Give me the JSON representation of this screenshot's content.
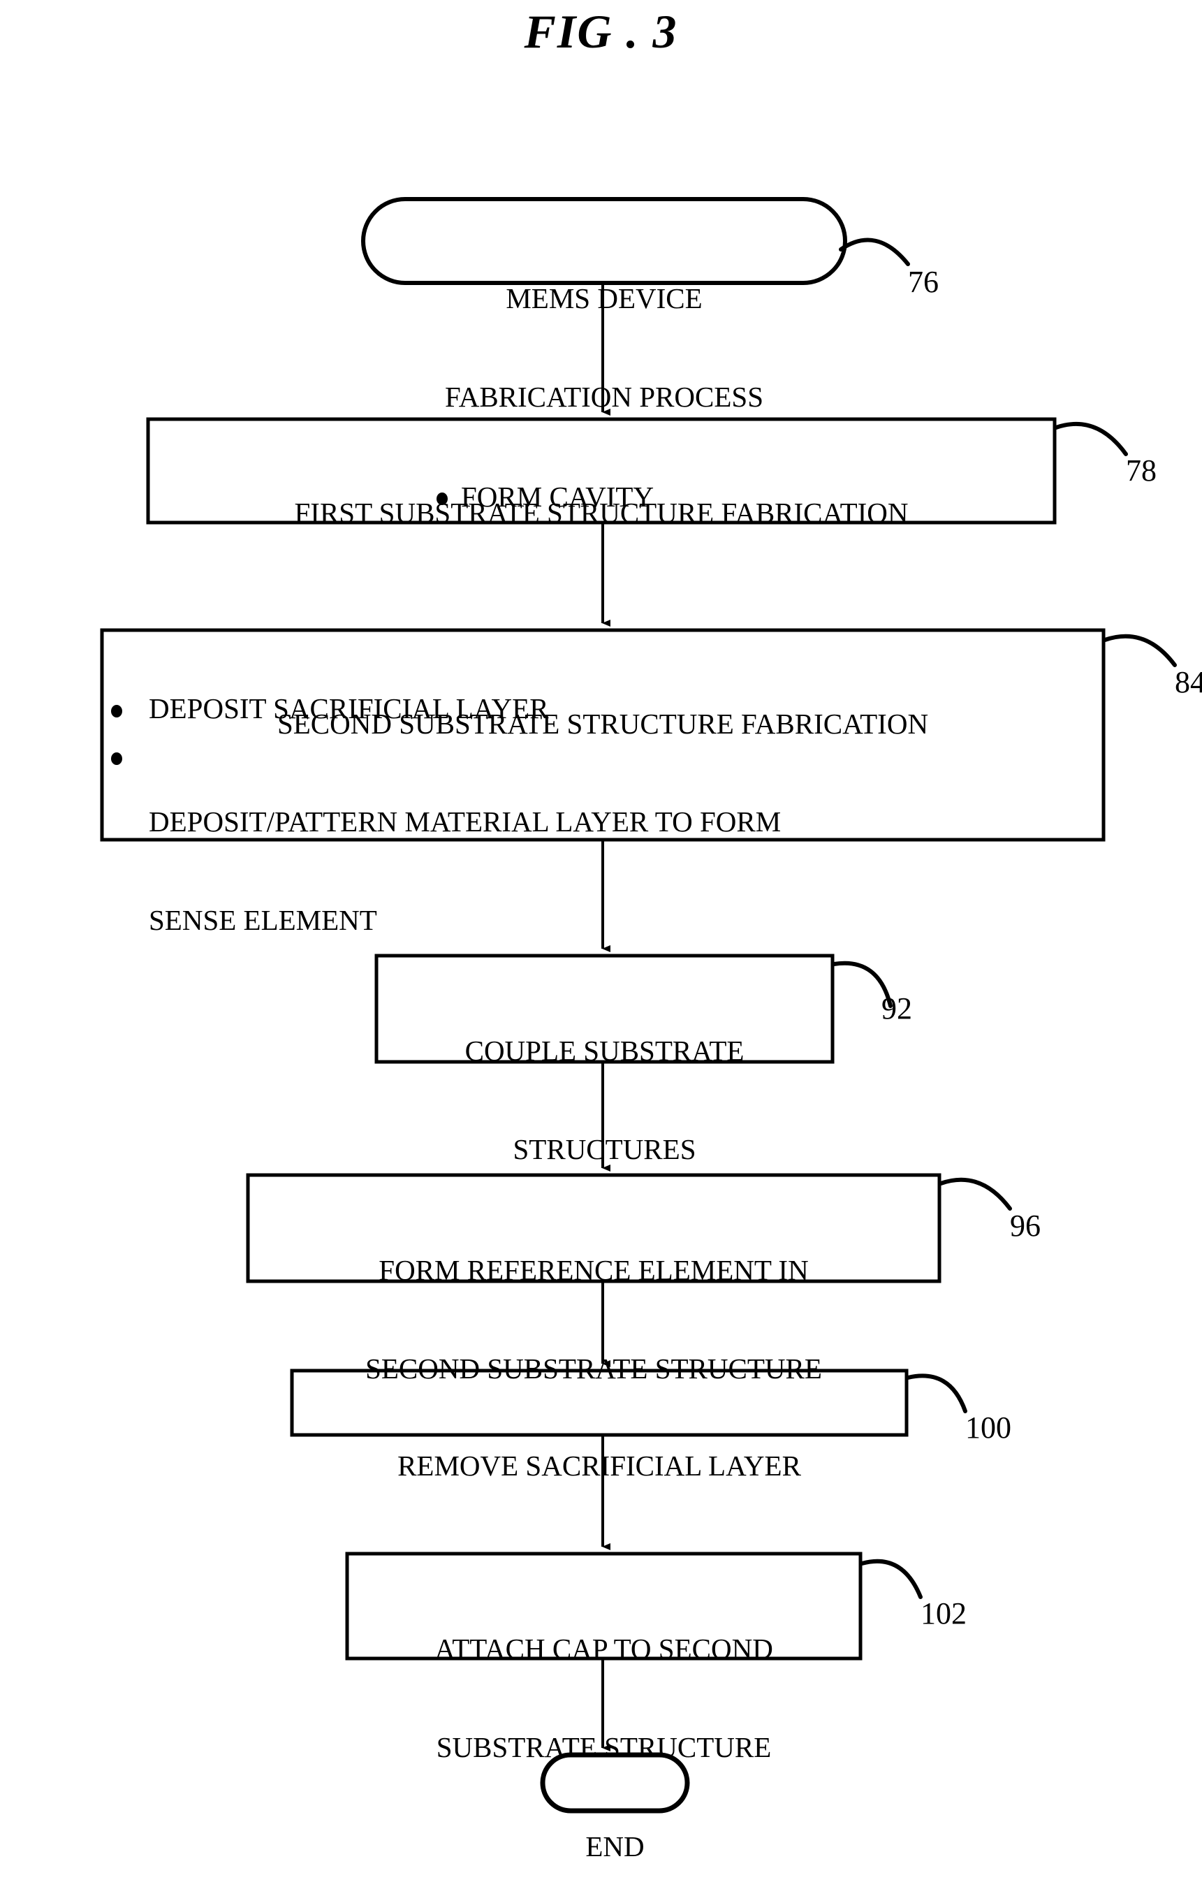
{
  "figure": {
    "title": "FIG . 3",
    "type": "flowchart",
    "background_color": "#ffffff",
    "line_color": "#000000"
  },
  "nodes": [
    {
      "id": "start",
      "shape": "rounded-terminal",
      "ref": "76",
      "lines": [
        "MEMS DEVICE",
        "FABRICATION PROCESS"
      ],
      "bullets": []
    },
    {
      "id": "first-substrate",
      "shape": "rectangle",
      "ref": "78",
      "lines": [
        "FIRST SUBSTRATE STRUCTURE FABRICATION"
      ],
      "bullets": [
        "FORM CAVITY"
      ]
    },
    {
      "id": "second-substrate",
      "shape": "rectangle",
      "ref": "84",
      "lines": [
        "SECOND SUBSTRATE STRUCTURE FABRICATION"
      ],
      "bullets": [
        "DEPOSIT SACRIFICIAL LAYER",
        "DEPOSIT/PATTERN MATERIAL LAYER TO FORM SENSE ELEMENT"
      ]
    },
    {
      "id": "couple",
      "shape": "rectangle",
      "ref": "92",
      "lines": [
        "COUPLE SUBSTRATE",
        "STRUCTURES"
      ],
      "bullets": []
    },
    {
      "id": "form-reference",
      "shape": "rectangle",
      "ref": "96",
      "lines": [
        "FORM REFERENCE ELEMENT IN",
        "SECOND SUBSTRATE STRUCTURE"
      ],
      "bullets": []
    },
    {
      "id": "remove-sacrificial",
      "shape": "rectangle",
      "ref": "100",
      "lines": [
        "REMOVE SACRIFICIAL LAYER"
      ],
      "bullets": []
    },
    {
      "id": "attach-cap",
      "shape": "rectangle",
      "ref": "102",
      "lines": [
        "ATTACH CAP TO SECOND",
        "SUBSTRATE STRUCTURE"
      ],
      "bullets": []
    },
    {
      "id": "end",
      "shape": "rounded-terminal",
      "ref": "",
      "lines": [
        "END"
      ],
      "bullets": []
    }
  ],
  "node_text": {
    "start_line1": "MEMS DEVICE",
    "start_line2": "FABRICATION PROCESS",
    "first_heading": "FIRST SUBSTRATE STRUCTURE FABRICATION",
    "first_bullet1": "FORM CAVITY",
    "second_heading": "SECOND SUBSTRATE STRUCTURE FABRICATION",
    "second_bullet1": "DEPOSIT SACRIFICIAL LAYER",
    "second_bullet2_line1": "DEPOSIT/PATTERN MATERIAL LAYER TO FORM",
    "second_bullet2_line2": "SENSE ELEMENT",
    "couple_line1": "COUPLE SUBSTRATE",
    "couple_line2": "STRUCTURES",
    "reference_line1": "FORM REFERENCE ELEMENT IN",
    "reference_line2": "SECOND SUBSTRATE STRUCTURE",
    "remove_line1": "REMOVE SACRIFICIAL LAYER",
    "attach_line1": "ATTACH CAP TO SECOND",
    "attach_line2": "SUBSTRATE STRUCTURE",
    "end_line1": "END"
  },
  "reference_numerals": {
    "start": "76",
    "first_substrate": "78",
    "second_substrate": "84",
    "couple": "92",
    "form_reference": "96",
    "remove_sacrificial": "100",
    "attach_cap": "102"
  },
  "bullet_glyph": "•",
  "connectors": [
    {
      "from": "start",
      "to": "first-substrate"
    },
    {
      "from": "first-substrate",
      "to": "second-substrate"
    },
    {
      "from": "second-substrate",
      "to": "couple"
    },
    {
      "from": "couple",
      "to": "form-reference"
    },
    {
      "from": "form-reference",
      "to": "remove-sacrificial"
    },
    {
      "from": "remove-sacrificial",
      "to": "attach-cap"
    },
    {
      "from": "attach-cap",
      "to": "end"
    }
  ]
}
